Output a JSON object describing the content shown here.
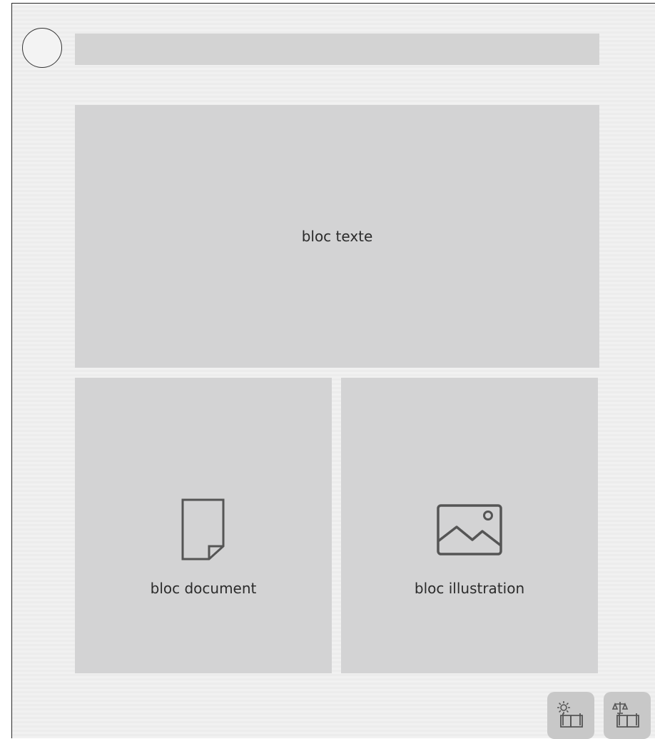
{
  "blocks": {
    "text": {
      "label": "bloc texte"
    },
    "document": {
      "label": "bloc document",
      "icon": "document-icon"
    },
    "illustration": {
      "label": "bloc illustration",
      "icon": "image-icon"
    }
  },
  "toolbar": {
    "settings": {
      "icon": "settings-book-icon"
    },
    "legal": {
      "icon": "scales-book-icon"
    }
  },
  "colors": {
    "block_fill": "#d3d3d4",
    "button_fill": "#c8c8c8",
    "icon_stroke": "#555555"
  }
}
